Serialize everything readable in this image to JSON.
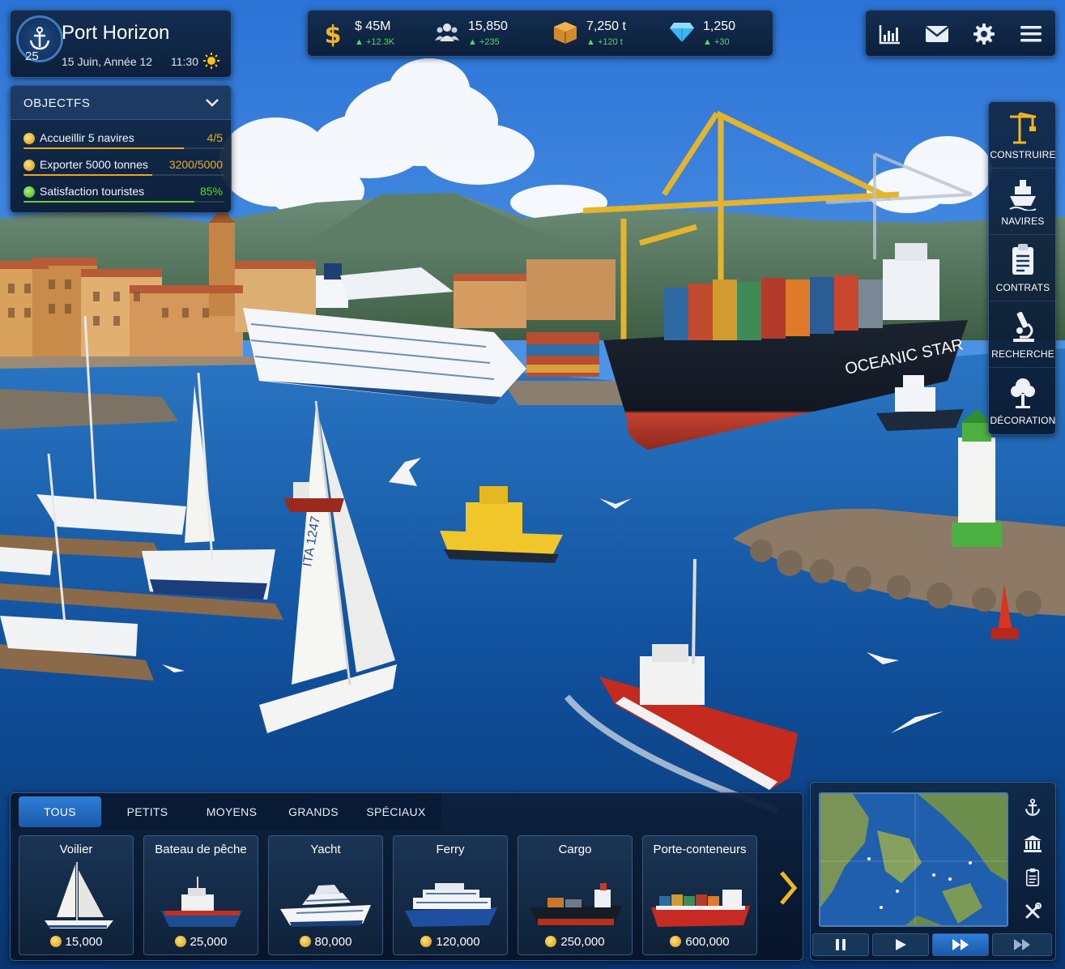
{
  "port": {
    "name": "Port Horizon",
    "level": "25",
    "date": "15 Juin, Année 12",
    "time": "11:30",
    "weather_icon": "sun-icon"
  },
  "objectives": {
    "title": "OBJECTFS",
    "items": [
      {
        "label": "Accueillir 5 navires",
        "value": "4/5",
        "progress": 0.8,
        "color": "#e7a820"
      },
      {
        "label": "Exporter 5000 tonnes",
        "value": "3200/5000",
        "progress": 0.64,
        "color": "#e7a820"
      },
      {
        "label": "Satisfaction touristes",
        "value": "85%",
        "progress": 0.85,
        "color": "#6bd12f"
      }
    ]
  },
  "resources": {
    "money": {
      "value": "$ 45M",
      "delta": "▲ +12.3K",
      "icon": "dollar-icon"
    },
    "population": {
      "value": "15,850",
      "delta": "▲ +235",
      "icon": "people-icon"
    },
    "cargo": {
      "value": "7,250 t",
      "delta": "▲ +120 t",
      "icon": "crate-icon"
    },
    "gems": {
      "value": "1,250",
      "delta": "▲ +30",
      "icon": "diamond-icon"
    }
  },
  "top_buttons": [
    "stats-icon",
    "mail-icon",
    "gear-icon",
    "hamburger-menu-icon"
  ],
  "side_menu": [
    {
      "label": "CONSTRUIRE",
      "icon": "crane-icon"
    },
    {
      "label": "NAVIRES",
      "icon": "ship-icon"
    },
    {
      "label": "CONTRATS",
      "icon": "clipboard-icon"
    },
    {
      "label": "RECHERCHE",
      "icon": "microscope-icon"
    },
    {
      "label": "DÉCORATION",
      "icon": "tree-icon"
    }
  ],
  "shop": {
    "tabs": [
      "TOUS",
      "PETITS",
      "MOYENS",
      "GRANDS",
      "SPÉCIAUX"
    ],
    "active_tab": "TOUS",
    "ships": [
      {
        "name": "Voilier",
        "price": "15,000"
      },
      {
        "name": "Bateau de pêche",
        "price": "25,000"
      },
      {
        "name": "Yacht",
        "price": "80,000"
      },
      {
        "name": "Ferry",
        "price": "120,000"
      },
      {
        "name": "Cargo",
        "price": "250,000"
      },
      {
        "name": "Porte-conteneurs",
        "price": "600,000"
      }
    ]
  },
  "scene": {
    "cargo_ship_name": "OCEANIC STAR",
    "sail_number": "ITA 1247"
  },
  "minimap": {
    "side_buttons": [
      "anchor-icon",
      "bank-icon",
      "clipboard-icon",
      "tools-icon"
    ],
    "speed_buttons": [
      "pause-icon",
      "play-icon",
      "fast-forward-icon",
      "fastest-forward-icon"
    ],
    "active_speed": "fast-forward-icon"
  },
  "colors": {
    "panel": "#0f2546",
    "accent": "#2d7fd8",
    "gold": "#e7a820",
    "green": "#4de052"
  }
}
